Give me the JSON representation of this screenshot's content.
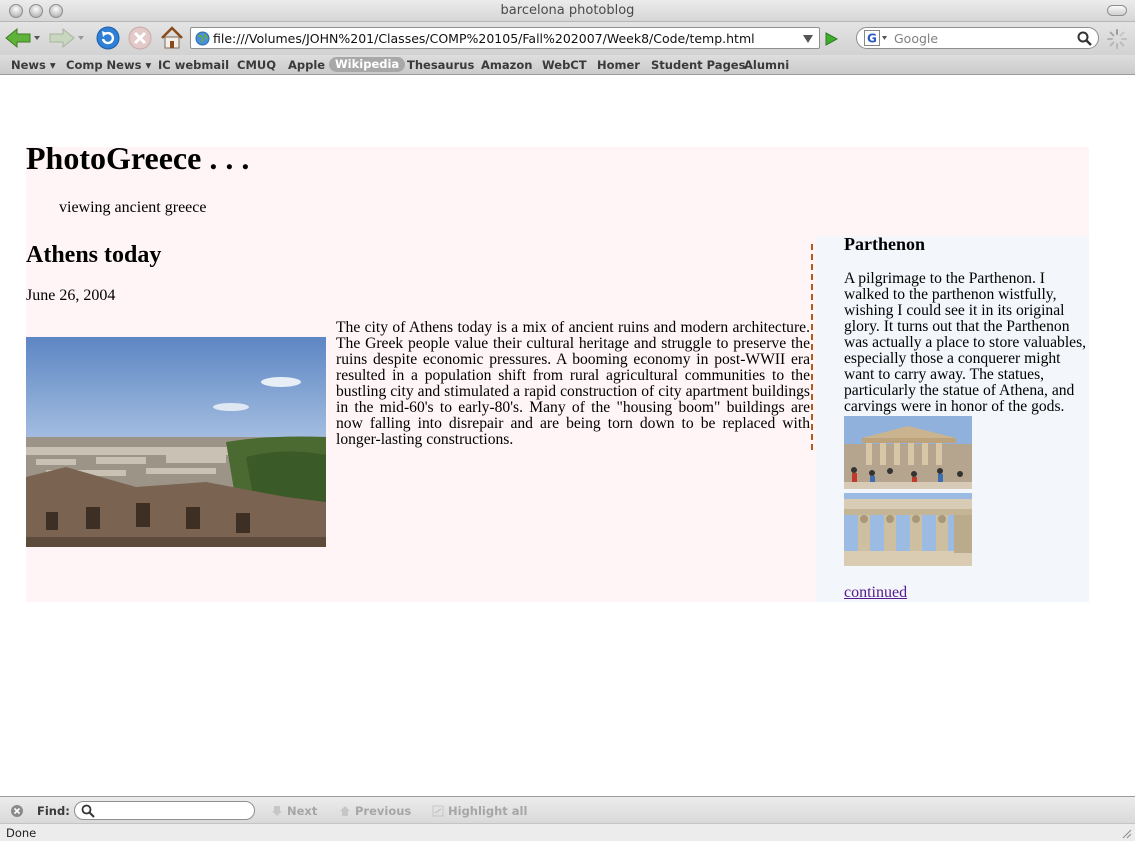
{
  "window": {
    "title": "barcelona photoblog"
  },
  "toolbar": {
    "url": "file:///Volumes/JOHN%201/Classes/COMP%20105/Fall%202007/Week8/Code/temp.html",
    "search_placeholder": "Google"
  },
  "bookmarks": [
    {
      "label": "News ▾"
    },
    {
      "label": "Comp News ▾"
    },
    {
      "label": "IC webmail"
    },
    {
      "label": "CMUQ"
    },
    {
      "label": "Apple"
    },
    {
      "label": "Wikipedia",
      "active": true
    },
    {
      "label": "Thesaurus"
    },
    {
      "label": "Amazon"
    },
    {
      "label": "WebCT"
    },
    {
      "label": "Homer"
    },
    {
      "label": "Student Pages"
    },
    {
      "label": "Alumni"
    }
  ],
  "page": {
    "site_title": "PhotoGreece . . .",
    "tagline": "viewing ancient greece",
    "post": {
      "title": "Athens today",
      "date": "June 26, 2004",
      "body": "The city of Athens today is a mix of ancient ruins and modern architecture. The Greek people value their cultural heritage and struggle to preserve the ruins despite economic pressures. A booming economy in post-WWII era resulted in a population shift from rural agricultural communities to the bustling city and stimulated a rapid construction of city apartment buildings in the mid-60's to early-80's. Many of the \"housing boom\" buildings are now falling into disrepair and are being torn down to be replaced with longer-lasting constructions."
    },
    "sidebar": {
      "title": "Parthenon",
      "body": "A pilgrimage to the Parthenon. I walked to the parthenon wistfully, wishing I could see it in its original glory. It turns out that the Parthenon was actually a place to store valuables, especially those a conquerer might want to carry away. The statues, particularly the statue of Athena, and carvings were in honor of the gods.",
      "link": "continued"
    }
  },
  "findbar": {
    "label": "Find:",
    "next": "Next",
    "previous": "Previous",
    "highlight": "Highlight all"
  },
  "status": {
    "text": "Done"
  },
  "colors": {
    "header_bg": "#fff5f6",
    "sidebar_bg": "#f3f6fa",
    "divider": "#b35a1f",
    "visited_link": "#551a8b"
  }
}
